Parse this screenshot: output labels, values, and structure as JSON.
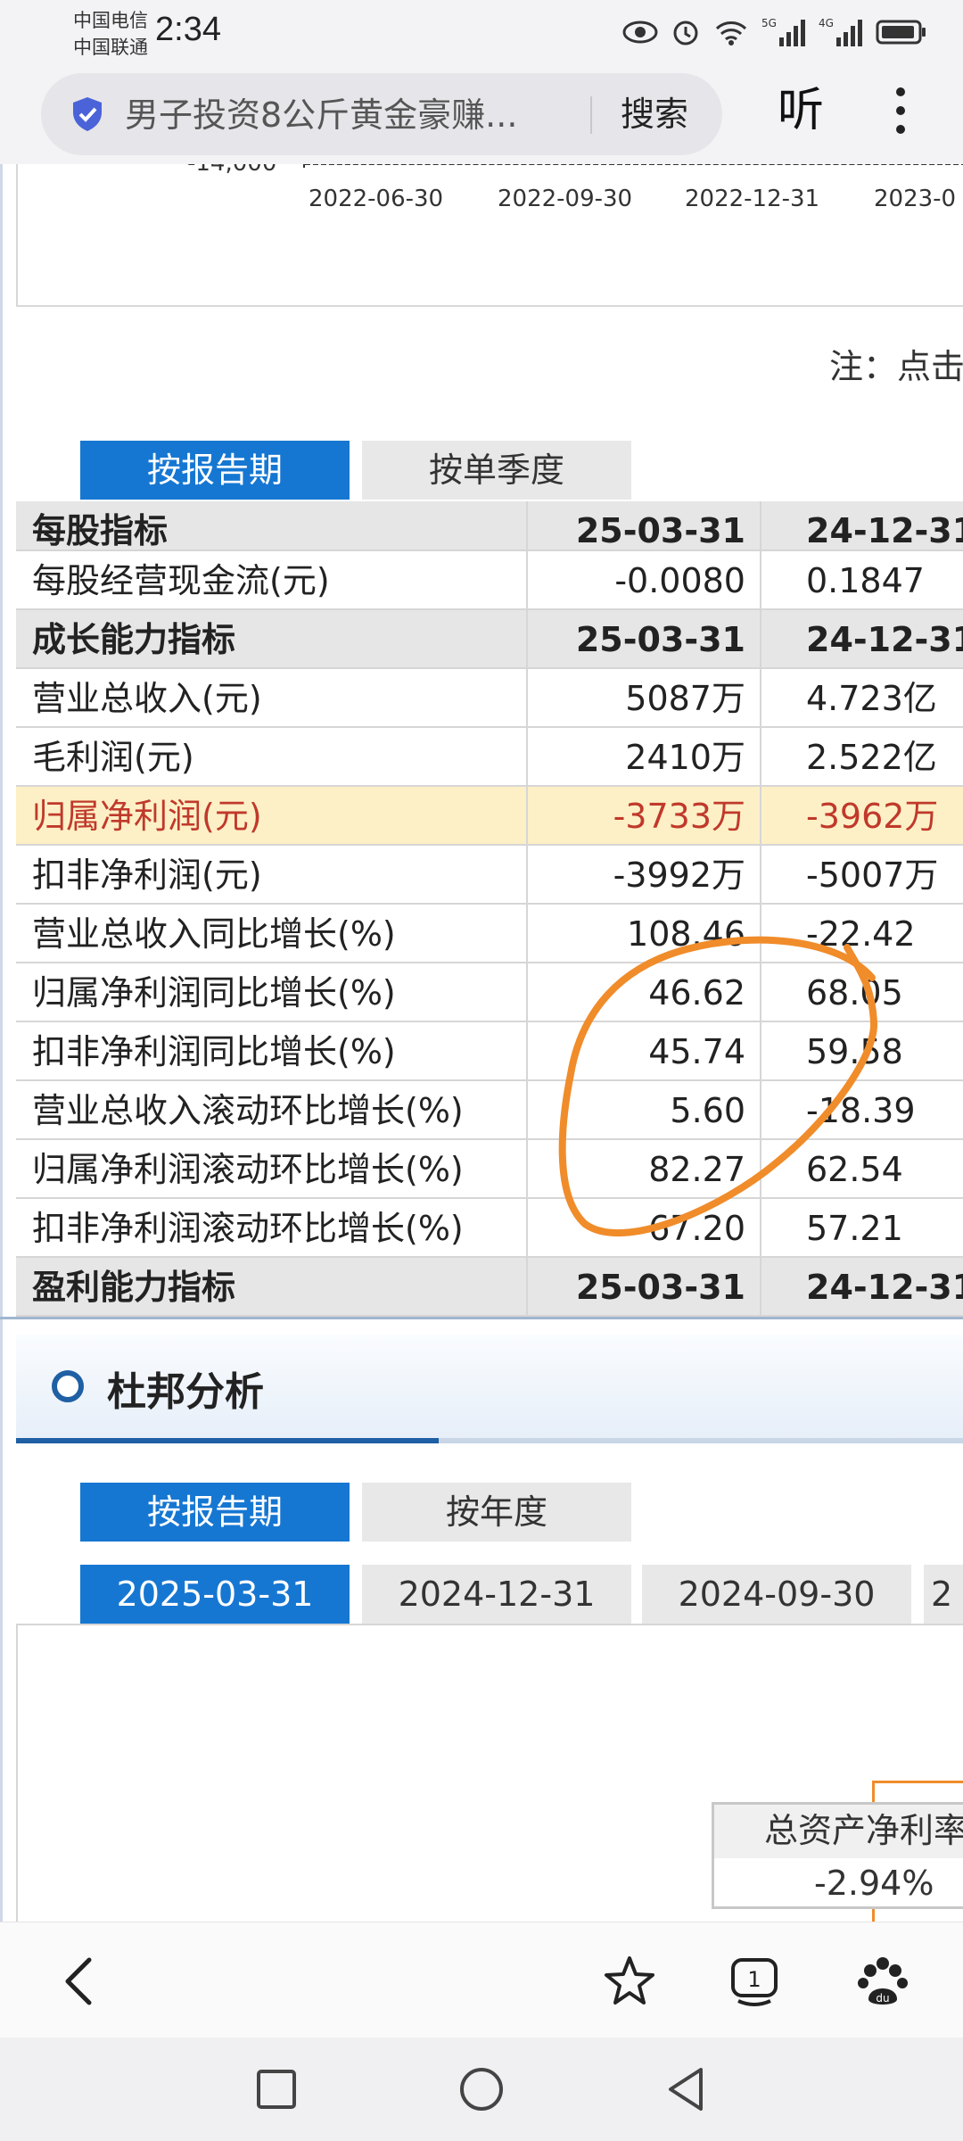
{
  "status_bar": {
    "carrier_1": "中国电信",
    "carrier_2": "中国联通",
    "time": "2:34",
    "battery_icon": "battery-icon",
    "icons": [
      "eye-icon",
      "alarm-icon",
      "wifi-icon",
      "signal-5g-icon",
      "signal-4g-icon",
      "battery-icon"
    ]
  },
  "browser": {
    "address_text": "男子投资8公斤黄金豪赚...",
    "search_label": "搜索",
    "listen_label": "听"
  },
  "chart_data": {
    "type": "line",
    "yticks": [
      "-14,000"
    ],
    "xticks": [
      "2022-06-30",
      "2022-09-30",
      "2022-12-31",
      "2023-0"
    ]
  },
  "note": "注：点击",
  "report_tabs": [
    "按报告期",
    "按单季度"
  ],
  "table": {
    "rows": [
      {
        "kind": "header",
        "label": "每股指标",
        "v1": "25-03-31",
        "v2": "24-12-31"
      },
      {
        "kind": "row",
        "label": "每股经营现金流(元)",
        "v1": "-0.0080",
        "v2": "0.1847"
      },
      {
        "kind": "header",
        "label": "成长能力指标",
        "v1": "25-03-31",
        "v2": "24-12-31"
      },
      {
        "kind": "row",
        "label": "营业总收入(元)",
        "v1": "5087万",
        "v2": "4.723亿"
      },
      {
        "kind": "row",
        "label": "毛利润(元)",
        "v1": "2410万",
        "v2": "2.522亿"
      },
      {
        "kind": "highlight",
        "label": "归属净利润(元)",
        "v1": "-3733万",
        "v2": "-3962万"
      },
      {
        "kind": "row",
        "label": "扣非净利润(元)",
        "v1": "-3992万",
        "v2": "-5007万"
      },
      {
        "kind": "row",
        "label": "营业总收入同比增长(%)",
        "v1": "108.46",
        "v2": "-22.42"
      },
      {
        "kind": "row",
        "label": "归属净利润同比增长(%)",
        "v1": "46.62",
        "v2": "68.05"
      },
      {
        "kind": "row",
        "label": "扣非净利润同比增长(%)",
        "v1": "45.74",
        "v2": "59.58"
      },
      {
        "kind": "row",
        "label": "营业总收入滚动环比增长(%)",
        "v1": "5.60",
        "v2": "-18.39"
      },
      {
        "kind": "row",
        "label": "归属净利润滚动环比增长(%)",
        "v1": "82.27",
        "v2": "62.54"
      },
      {
        "kind": "row",
        "label": "扣非净利润滚动环比增长(%)",
        "v1": "67.20",
        "v2": "57.21"
      },
      {
        "kind": "header",
        "label": "盈利能力指标",
        "v1": "25-03-31",
        "v2": "24-12-31"
      }
    ]
  },
  "dupont": {
    "title": "杜邦分析",
    "mode_tabs": [
      "按报告期",
      "按年度"
    ],
    "date_tabs": [
      "2025-03-31",
      "2024-12-31",
      "2024-09-30",
      "2"
    ],
    "metric_label": "总资产净利率",
    "metric_value": "-2.94%"
  },
  "colors": {
    "accent": "#1677d2",
    "highlight_row": "#fdf0c6",
    "negative_text": "#c0392b",
    "annotation": "#f08c2a"
  }
}
